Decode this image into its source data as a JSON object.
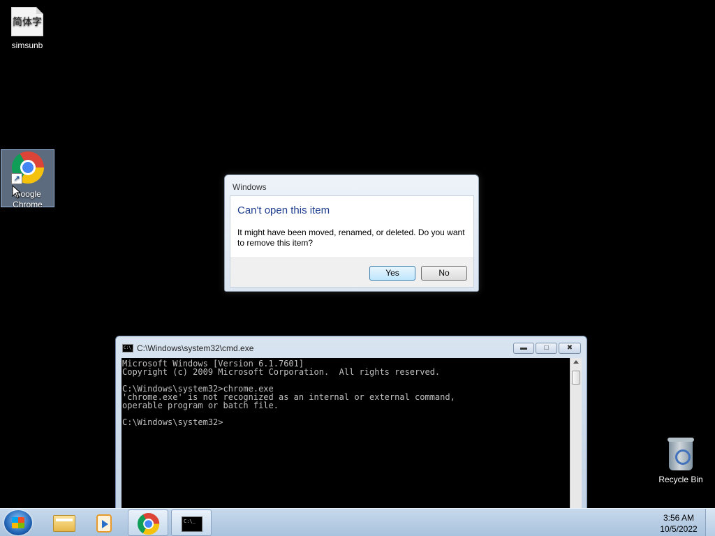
{
  "desktop": {
    "icons": [
      {
        "label": "simsunb",
        "preview_text": "简体字",
        "icon": "font-file-icon"
      },
      {
        "label": "Google Chrome",
        "icon": "chrome-icon",
        "selected": true
      },
      {
        "label": "Recycle Bin",
        "icon": "recycle-bin-icon"
      }
    ]
  },
  "dialog": {
    "title": "Windows",
    "heading": "Can't open this item",
    "message": "It might have been moved, renamed, or deleted. Do you want to remove this item?",
    "yes_label": "Yes",
    "no_label": "No"
  },
  "cmd_window": {
    "title": "C:\\Windows\\system32\\cmd.exe",
    "icon_text": "C:\\_",
    "output": "Microsoft Windows [Version 6.1.7601]\nCopyright (c) 2009 Microsoft Corporation.  All rights reserved.\n\nC:\\Windows\\system32>chrome.exe\n'chrome.exe' is not recognized as an internal or external command,\noperable program or batch file.\n\nC:\\Windows\\system32>"
  },
  "taskbar": {
    "items": [
      {
        "name": "Windows Explorer",
        "icon": "folder-icon"
      },
      {
        "name": "Windows Media Player",
        "icon": "media-player-icon"
      },
      {
        "name": "Google Chrome",
        "icon": "chrome-icon",
        "active": true
      },
      {
        "name": "cmd.exe",
        "icon": "cmd-icon",
        "active": true
      }
    ],
    "tb_cmd_text": "C:\\_",
    "clock_time": "3:56 AM",
    "clock_date": "10/5/2022"
  },
  "colors": {
    "desktop_bg": "#000000",
    "dialog_heading": "#1e3d8f",
    "taskbar": "#b9cfe6"
  }
}
